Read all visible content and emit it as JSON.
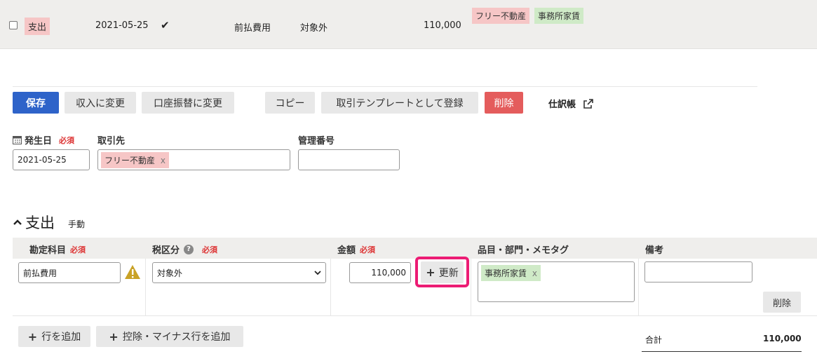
{
  "summary": {
    "type": "支出",
    "date": "2021-05-25",
    "account": "前払費用",
    "tax": "対象外",
    "amount": "110,000",
    "tags": [
      "フリー不動産",
      "事務所家賃"
    ]
  },
  "toolbar": {
    "save": "保存",
    "to_income": "収入に変更",
    "to_transfer": "口座振替に変更",
    "copy": "コピー",
    "register_template": "取引テンプレートとして登録",
    "delete": "削除",
    "journal": "仕訳帳"
  },
  "form": {
    "date_label": "発生日",
    "required": "必須",
    "date_value": "2021-05-25",
    "partner_label": "取引先",
    "partner_tag": "フリー不動産",
    "tag_remove": "x",
    "mgmt_label": "管理番号",
    "mgmt_value": ""
  },
  "section": {
    "title": "支出",
    "mode": "手動"
  },
  "table": {
    "headers": {
      "account": "勘定科目",
      "tax": "税区分",
      "amount": "金額",
      "items": "品目・部門・メモタグ",
      "remarks": "備考"
    },
    "row": {
      "account": "前払費用",
      "tax": "対象外",
      "amount": "110,000",
      "update": "更新",
      "tag": "事務所家賃",
      "remarks": "",
      "delete": "削除"
    },
    "add_row": "行を追加",
    "add_deduction": "控除・マイナス行を追加",
    "total_label": "合計",
    "total_value": "110,000"
  },
  "colors": {
    "primary": "#2e63c9",
    "danger": "#e45c5c",
    "highlight": "#ec1c74",
    "tag_pink": "#f6c6c6",
    "tag_green": "#cfeac7",
    "warning": "#c9a227"
  }
}
